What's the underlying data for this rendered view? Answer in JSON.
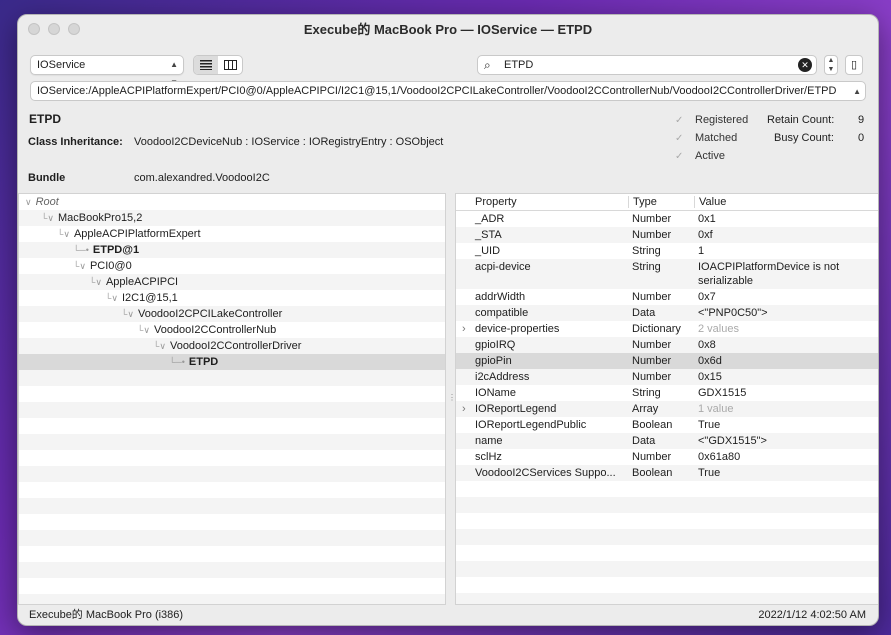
{
  "window": {
    "title": "Execube的 MacBook Pro — IOService — ETPD"
  },
  "toolbar": {
    "plane_select": "IOService",
    "search_query": "ETPD",
    "path": "IOService:/AppleACPIPlatformExpert/PCI0@0/AppleACPIPCI/I2C1@15,1/VoodooI2CPCILakeController/VoodooI2CControllerNub/VoodooI2CControllerDriver/ETPD"
  },
  "info": {
    "class_name": "ETPD",
    "inheritance_label": "Class Inheritance:",
    "inheritance": "VoodooI2CDeviceNub : IOService : IORegistryEntry : OSObject",
    "bundle_label": "Bundle",
    "bundle": "com.alexandred.VoodooI2C",
    "checks": [
      {
        "label": "Registered",
        "checked": true
      },
      {
        "label": "Matched",
        "checked": true
      },
      {
        "label": "Active",
        "checked": true
      }
    ],
    "retain_label": "Retain Count:",
    "retain_value": "9",
    "busy_label": "Busy Count:",
    "busy_value": "0"
  },
  "tree": [
    {
      "label": "Root",
      "depth": 0,
      "expanded": true,
      "style": "italic"
    },
    {
      "label": "MacBookPro15,2",
      "depth": 1,
      "expanded": true
    },
    {
      "label": "AppleACPIPlatformExpert",
      "depth": 2,
      "expanded": true
    },
    {
      "label": "ETPD@1",
      "depth": 3,
      "leaf": true,
      "style": "bold"
    },
    {
      "label": "PCI0@0",
      "depth": 3,
      "expanded": true
    },
    {
      "label": "AppleACPIPCI",
      "depth": 4,
      "expanded": true
    },
    {
      "label": "I2C1@15,1",
      "depth": 5,
      "expanded": true
    },
    {
      "label": "VoodooI2CPCILakeController",
      "depth": 6,
      "expanded": true
    },
    {
      "label": "VoodooI2CControllerNub",
      "depth": 7,
      "expanded": true
    },
    {
      "label": "VoodooI2CControllerDriver",
      "depth": 8,
      "expanded": true
    },
    {
      "label": "ETPD",
      "depth": 9,
      "leaf": true,
      "style": "bold",
      "selected": true
    }
  ],
  "properties": {
    "headers": [
      "Property",
      "Type",
      "Value"
    ],
    "rows": [
      {
        "key": "_ADR",
        "type": "Number",
        "value": "0x1"
      },
      {
        "key": "_STA",
        "type": "Number",
        "value": "0xf"
      },
      {
        "key": "_UID",
        "type": "String",
        "value": "1"
      },
      {
        "key": "acpi-device",
        "type": "String",
        "value": "IOACPIPlatformDevice is not serializable",
        "tall": true
      },
      {
        "key": "addrWidth",
        "type": "Number",
        "value": "0x7"
      },
      {
        "key": "compatible",
        "type": "Data",
        "value": "<\"PNP0C50\">"
      },
      {
        "key": "device-properties",
        "type": "Dictionary",
        "value": "2 values",
        "expandable": true,
        "dim": true
      },
      {
        "key": "gpioIRQ",
        "type": "Number",
        "value": "0x8"
      },
      {
        "key": "gpioPin",
        "type": "Number",
        "value": "0x6d",
        "selected": true
      },
      {
        "key": "i2cAddress",
        "type": "Number",
        "value": "0x15"
      },
      {
        "key": "IOName",
        "type": "String",
        "value": "GDX1515"
      },
      {
        "key": "IOReportLegend",
        "type": "Array",
        "value": "1 value",
        "expandable": true,
        "dim": true
      },
      {
        "key": "IOReportLegendPublic",
        "type": "Boolean",
        "value": "True"
      },
      {
        "key": "name",
        "type": "Data",
        "value": "<\"GDX1515\">"
      },
      {
        "key": "sclHz",
        "type": "Number",
        "value": "0x61a80"
      },
      {
        "key": "VoodooI2CServices Suppo...",
        "type": "Boolean",
        "value": "True"
      }
    ]
  },
  "status": {
    "left": "Execube的 MacBook Pro (i386)",
    "right": "2022/1/12 4:02:50 AM"
  }
}
